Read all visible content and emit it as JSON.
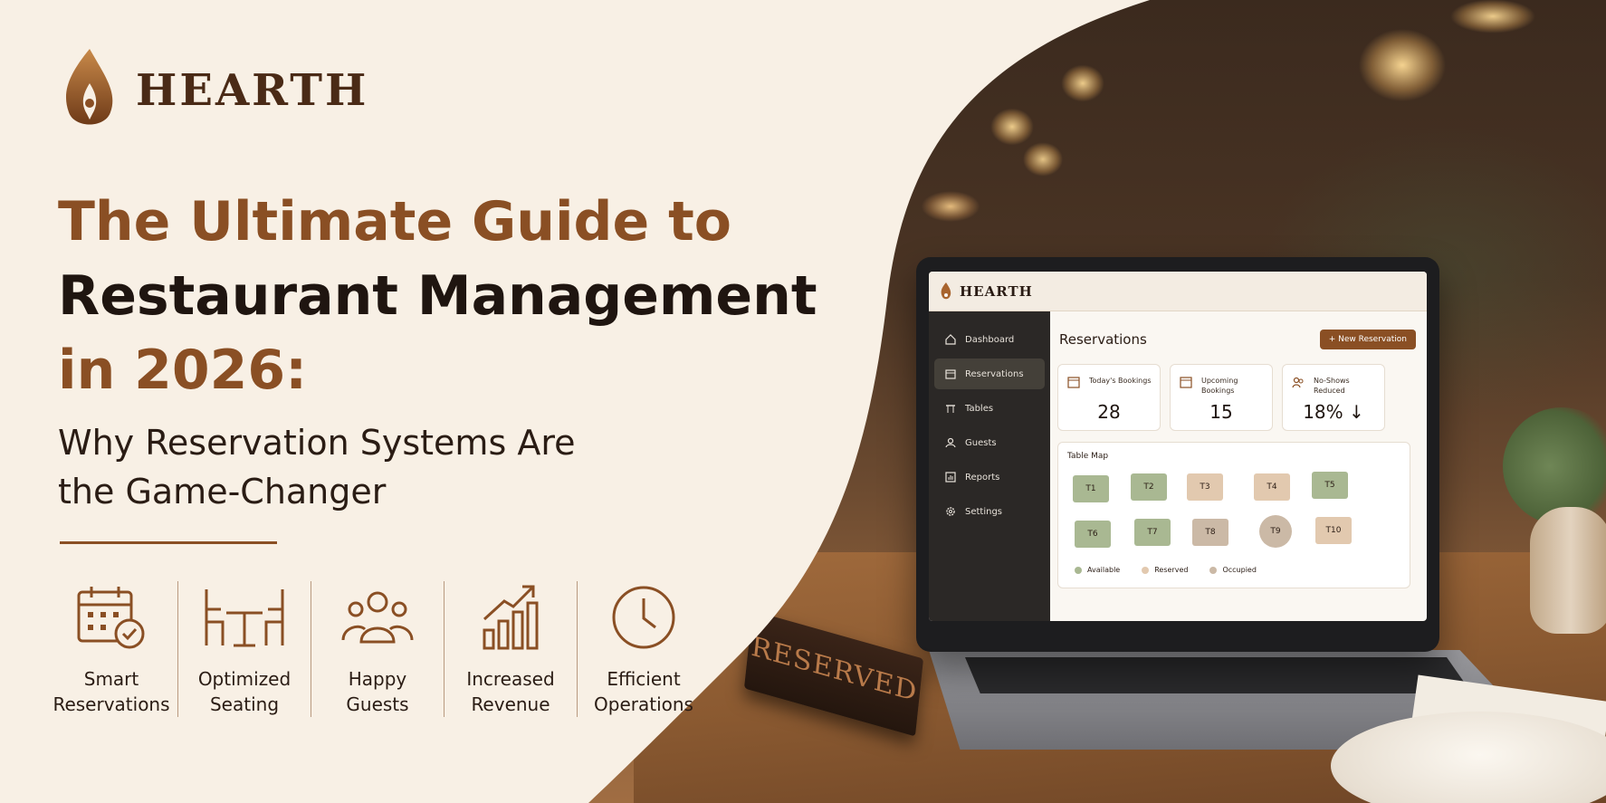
{
  "brand": {
    "name": "HEARTH"
  },
  "headline": {
    "line1": "The Ultimate Guide to",
    "line2": "Restaurant Management",
    "line3": "in 2026:",
    "subtitle": "Why Reservation Systems Are the Game-Changer"
  },
  "features": [
    {
      "icon": "calendar-check-icon",
      "label": "Smart Reservations"
    },
    {
      "icon": "table-chairs-icon",
      "label": "Optimized Seating"
    },
    {
      "icon": "guests-icon",
      "label": "Happy Guests"
    },
    {
      "icon": "growth-chart-icon",
      "label": "Increased Revenue"
    },
    {
      "icon": "clock-icon",
      "label": "Efficient Operations"
    }
  ],
  "app": {
    "brand": "HEARTH",
    "sidebar": [
      {
        "label": "Dashboard",
        "icon": "home-icon"
      },
      {
        "label": "Reservations",
        "icon": "calendar-icon",
        "active": true
      },
      {
        "label": "Tables",
        "icon": "table-icon"
      },
      {
        "label": "Guests",
        "icon": "user-icon"
      },
      {
        "label": "Reports",
        "icon": "report-icon"
      },
      {
        "label": "Settings",
        "icon": "gear-icon"
      }
    ],
    "page_title": "Reservations",
    "new_button": "+ New Reservation",
    "cards": [
      {
        "label": "Today's Bookings",
        "value": "28",
        "icon": "calendar-icon"
      },
      {
        "label": "Upcoming Bookings",
        "value": "15",
        "icon": "calendar-icon"
      },
      {
        "label": "No-Shows Reduced",
        "value": "18% ↓",
        "icon": "users-icon"
      }
    ],
    "table_map": {
      "title": "Table Map",
      "tables": [
        {
          "id": "T1",
          "status": "available"
        },
        {
          "id": "T2",
          "status": "available"
        },
        {
          "id": "T3",
          "status": "reserved"
        },
        {
          "id": "T4",
          "status": "reserved"
        },
        {
          "id": "T5",
          "status": "available"
        },
        {
          "id": "T6",
          "status": "available"
        },
        {
          "id": "T7",
          "status": "available"
        },
        {
          "id": "T8",
          "status": "occupied"
        },
        {
          "id": "T9",
          "status": "occupied"
        },
        {
          "id": "T10",
          "status": "reserved"
        }
      ],
      "legend": {
        "available": "Available",
        "reserved": "Reserved",
        "occupied": "Occupied"
      }
    }
  },
  "sign": {
    "text": "RESERVED"
  },
  "colors": {
    "accent": "#8a4f24",
    "dark": "#1f1510",
    "available": "#a9b892",
    "reserved": "#e2c9af",
    "occupied": "#cbb9a6"
  }
}
